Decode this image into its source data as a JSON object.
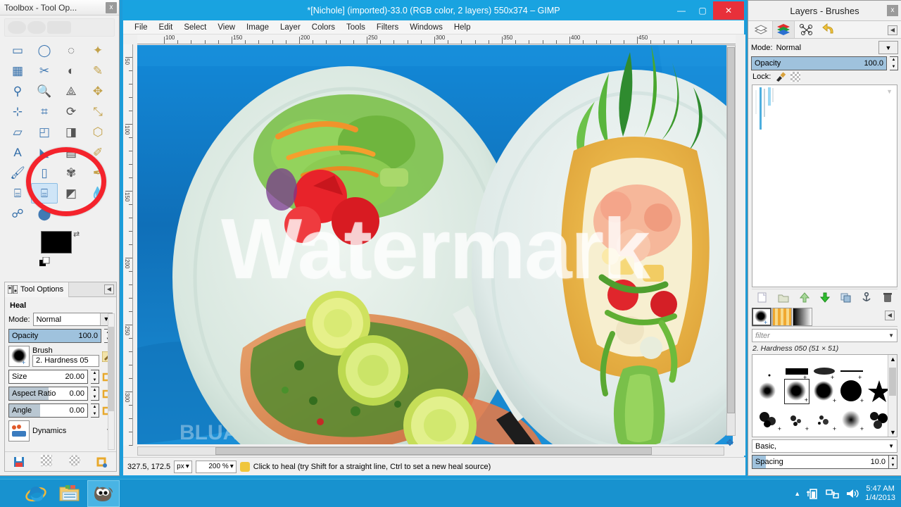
{
  "toolbox": {
    "title": "Toolbox - Tool Op...",
    "close_label": "x",
    "tools": [
      {
        "name": "rect-select-tool",
        "glyph": "▭"
      },
      {
        "name": "ellipse-select-tool",
        "glyph": "◯"
      },
      {
        "name": "free-select-tool",
        "glyph": "◌"
      },
      {
        "name": "fuzzy-select-tool",
        "glyph": "✦"
      },
      {
        "name": "select-by-color-tool",
        "glyph": "▦"
      },
      {
        "name": "scissors-select-tool",
        "glyph": "✂"
      },
      {
        "name": "foreground-select-tool",
        "glyph": "◐"
      },
      {
        "name": "paths-tool",
        "glyph": "✎"
      },
      {
        "name": "color-picker-tool",
        "glyph": "⚲"
      },
      {
        "name": "zoom-tool",
        "glyph": "🔍"
      },
      {
        "name": "measure-tool",
        "glyph": "⟁"
      },
      {
        "name": "move-tool",
        "glyph": "✥"
      },
      {
        "name": "align-tool",
        "glyph": "⊹"
      },
      {
        "name": "crop-tool",
        "glyph": "⌗"
      },
      {
        "name": "rotate-tool",
        "glyph": "⟳"
      },
      {
        "name": "scale-tool",
        "glyph": "⤡"
      },
      {
        "name": "shear-tool",
        "glyph": "▱"
      },
      {
        "name": "perspective-tool",
        "glyph": "◰"
      },
      {
        "name": "flip-tool",
        "glyph": "◨"
      },
      {
        "name": "cage-transform-tool",
        "glyph": "⬡"
      },
      {
        "name": "text-tool",
        "glyph": "A"
      },
      {
        "name": "bucket-fill-tool",
        "glyph": "◣"
      },
      {
        "name": "blend-tool",
        "glyph": "▤"
      },
      {
        "name": "pencil-tool",
        "glyph": "✐"
      },
      {
        "name": "paintbrush-tool",
        "glyph": "🖌"
      },
      {
        "name": "eraser-tool",
        "glyph": "▯"
      },
      {
        "name": "airbrush-tool",
        "glyph": "✾"
      },
      {
        "name": "ink-tool",
        "glyph": "✒"
      },
      {
        "name": "clone-tool",
        "glyph": "⌸"
      },
      {
        "name": "heal-tool",
        "glyph": "⌸"
      },
      {
        "name": "perspective-clone-tool",
        "glyph": "◩"
      },
      {
        "name": "blur-sharpen-tool",
        "glyph": "💧"
      },
      {
        "name": "smudge-tool",
        "glyph": "☍"
      },
      {
        "name": "dodge-burn-tool",
        "glyph": "⬤"
      }
    ],
    "selected_tool": "heal-tool",
    "foreground_color": "#000000",
    "background_color": "#ffffff"
  },
  "tool_options": {
    "tab_label": "Tool Options",
    "tool_name": "Heal",
    "mode_label": "Mode:",
    "mode_value": "Normal",
    "opacity_label": "Opacity",
    "opacity_value": "100.0",
    "brush_label": "Brush",
    "brush_value": "2. Hardness 05",
    "size_label": "Size",
    "size_value": "20.00",
    "aspect_label": "Aspect Ratio",
    "aspect_value": "0.00",
    "angle_label": "Angle",
    "angle_value": "0.00",
    "dynamics_label": "Dynamics"
  },
  "image_window": {
    "title": "*[Nichole] (imported)-33.0 (RGB color, 2 layers) 550x374 – GIMP",
    "minimize_label": "—",
    "maximize_label": "▢",
    "close_label": "✕",
    "menus": [
      "File",
      "Edit",
      "Select",
      "View",
      "Image",
      "Layer",
      "Colors",
      "Tools",
      "Filters",
      "Windows",
      "Help"
    ],
    "canvas_watermark_text": "Watermark",
    "ruler_h_labels": [
      "100",
      "150",
      "200",
      "250",
      "300",
      "350",
      "400",
      "450"
    ],
    "ruler_v_labels": [
      "50",
      "100",
      "150",
      "200",
      "250",
      "300"
    ],
    "status": {
      "position": "327.5, 172.5",
      "unit": "px",
      "zoom": "200 %",
      "hint": "Click to heal (try Shift for a straight line, Ctrl to set a new heal source)"
    }
  },
  "right_dock": {
    "title": "Layers - Brushes",
    "close_label": "x",
    "tabs": [
      {
        "name": "tab-layers-stack",
        "glyph": "▤"
      },
      {
        "name": "tab-channels",
        "glyph": "▦"
      },
      {
        "name": "tab-paths",
        "glyph": "✎"
      },
      {
        "name": "tab-undo-history",
        "glyph": "↺"
      }
    ],
    "mode_label": "Mode:",
    "mode_value": "Normal",
    "opacity_label": "Opacity",
    "opacity_value": "100.0",
    "lock_label": "Lock:",
    "layer_buttons": [
      {
        "name": "new-layer-button",
        "glyph": "🗋"
      },
      {
        "name": "new-layer-group-button",
        "glyph": "🗀"
      },
      {
        "name": "raise-layer-button",
        "glyph": "⬆"
      },
      {
        "name": "lower-layer-button",
        "glyph": "⬇"
      },
      {
        "name": "duplicate-layer-button",
        "glyph": "❐"
      },
      {
        "name": "anchor-layer-button",
        "glyph": "⚓"
      },
      {
        "name": "delete-layer-button",
        "glyph": "🗑"
      }
    ],
    "brush_tabs": [
      {
        "name": "tab-brushes",
        "glyph": "●"
      },
      {
        "name": "tab-patterns",
        "glyph": "▥"
      },
      {
        "name": "tab-gradients",
        "glyph": "▨"
      }
    ],
    "filter_placeholder": "filter",
    "brush_name": "2. Hardness 050 (51 × 51)",
    "brush_category": "Basic,",
    "spacing_label": "Spacing",
    "spacing_value": "10.0"
  },
  "taskbar": {
    "items": [
      {
        "name": "taskbar-internet-explorer",
        "label": "Internet Explorer",
        "active": false
      },
      {
        "name": "taskbar-file-explorer",
        "label": "File Explorer",
        "active": false
      },
      {
        "name": "taskbar-gimp",
        "label": "GIMP",
        "active": true
      }
    ],
    "tray": {
      "show_hidden_label": "▲",
      "time": "5:47 AM",
      "date": "1/4/2013"
    }
  },
  "colors": {
    "accent": "#19a3e0",
    "highlight_ring": "#f4232c",
    "taskbar": "#1892cf"
  }
}
